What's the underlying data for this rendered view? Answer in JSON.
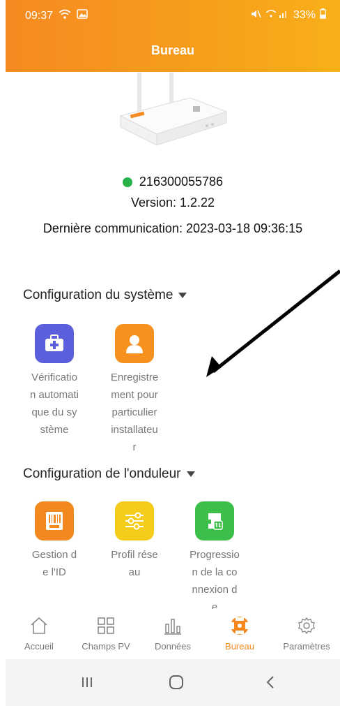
{
  "status_bar": {
    "time": "09:37",
    "battery": "33%",
    "icons": [
      "wifi-icon",
      "gallery-icon",
      "mute-icon",
      "signal-icon",
      "battery-icon"
    ]
  },
  "header": {
    "title": "Bureau"
  },
  "device": {
    "serial": "216300055786",
    "online_color": "#27b24a",
    "version": "Version: 1.2.22",
    "last_communication": "Dernière communication: 2023-03-18 09:36:15"
  },
  "sections": {
    "system": {
      "title": "Configuration du système",
      "items": [
        {
          "label": "Vérification automatique du système",
          "icon": "medical-kit-icon",
          "color": "#5b5fdb"
        },
        {
          "label": "Enregistrement pour particulier installateur",
          "icon": "user-icon",
          "color": "#f7911e"
        }
      ]
    },
    "inverter": {
      "title": "Configuration de l'onduleur",
      "items": [
        {
          "label": "Gestion de l'ID",
          "icon": "barcode-icon",
          "color": "#f2891f"
        },
        {
          "label": "Profil réseau",
          "icon": "sliders-icon",
          "color": "#f6cc1c"
        },
        {
          "label": "Progression de la connexion de",
          "icon": "connection-icon",
          "color": "#3cbf4a"
        }
      ]
    }
  },
  "bottom_nav": [
    {
      "label": "Accueil",
      "icon": "home-icon"
    },
    {
      "label": "Champs PV",
      "icon": "grid-icon"
    },
    {
      "label": "Données",
      "icon": "bar-chart-icon"
    },
    {
      "label": "Bureau",
      "icon": "office-icon",
      "active": true
    },
    {
      "label": "Paramètres",
      "icon": "settings-icon"
    }
  ],
  "colors": {
    "accent": "#f5881f",
    "header_start": "#f58a21",
    "header_end": "#f9b01a"
  }
}
